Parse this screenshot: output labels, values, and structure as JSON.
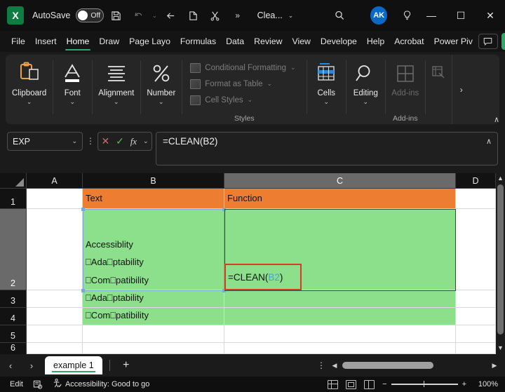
{
  "titlebar": {
    "logo": "X",
    "autosave_label": "AutoSave",
    "autosave_state": "Off",
    "icons": [
      "save-icon",
      "undo-icon",
      "redo-icon",
      "paste-icon",
      "cut-icon",
      "more-icon"
    ],
    "document_title": "Clea...",
    "avatar_initials": "AK",
    "minimize": "—",
    "maximize": "☐",
    "close": "✕"
  },
  "tabs": [
    {
      "label": "File",
      "active": false
    },
    {
      "label": "Insert",
      "active": false
    },
    {
      "label": "Home",
      "active": true
    },
    {
      "label": "Draw",
      "active": false
    },
    {
      "label": "Page Layo",
      "active": false
    },
    {
      "label": "Formulas",
      "active": false
    },
    {
      "label": "Data",
      "active": false
    },
    {
      "label": "Review",
      "active": false
    },
    {
      "label": "View",
      "active": false
    },
    {
      "label": "Develope",
      "active": false
    },
    {
      "label": "Help",
      "active": false
    },
    {
      "label": "Acrobat",
      "active": false
    },
    {
      "label": "Power Piv",
      "active": false
    }
  ],
  "ribbon": {
    "groups": [
      {
        "label": "Clipboard",
        "icon": "clipboard-icon",
        "disabled": false
      },
      {
        "label": "Font",
        "icon": "font-a-icon",
        "disabled": false
      },
      {
        "label": "Alignment",
        "icon": "alignment-lines-icon",
        "disabled": false
      },
      {
        "label": "Number",
        "icon": "percent-icon",
        "disabled": false
      }
    ],
    "styles": {
      "footer": "Styles",
      "items": [
        {
          "label": "Conditional Formatting",
          "has_chevron": true
        },
        {
          "label": "Format as Table",
          "has_chevron": true
        },
        {
          "label": "Cell Styles",
          "has_chevron": true
        }
      ]
    },
    "cells_group": {
      "label": "Cells",
      "icon": "cells-table-icon"
    },
    "editing_group": {
      "label": "Editing",
      "icon": "magnifier-icon"
    },
    "addins_group": {
      "label": "Add-ins",
      "footer": "Add-ins",
      "icon": "addins-grid-icon"
    },
    "overflow_label": "›",
    "collapse_label": "∧"
  },
  "formulabar": {
    "namebox_value": "EXP",
    "namebox_chevron": "∨",
    "cancel_icon": "✕",
    "enter_icon": "✓",
    "fx_label": "fx",
    "fx_chevron": "∨",
    "formula_value": "=CLEAN(B2)",
    "expand_icon": "∧"
  },
  "grid": {
    "columns": [
      {
        "label": "A",
        "selected": false
      },
      {
        "label": "B",
        "selected": false
      },
      {
        "label": "C",
        "selected": true
      },
      {
        "label": "D",
        "selected": false
      }
    ],
    "rows": [
      {
        "label": "1",
        "selected": false
      },
      {
        "label": "2",
        "selected": true
      },
      {
        "label": "3",
        "selected": false
      },
      {
        "label": "4",
        "selected": false
      },
      {
        "label": "5",
        "selected": false
      },
      {
        "label": "6",
        "selected": false
      }
    ],
    "cells": {
      "b1": "Text",
      "c1": "Function",
      "b2": "Accessiblity\n⎕Ada⎕ptability\n⎕Com⎕patibility",
      "b3": "⎕Ada⎕ptability",
      "b4": "⎕Com⎕patibility"
    },
    "edit_cell": {
      "prefix": "=CLEAN(",
      "reference": "B2",
      "suffix": ")"
    },
    "colors": {
      "header_fill": "#ED7D31",
      "data_fill": "#8CE08C",
      "edit_border": "#D83A26",
      "reference": "#4A9FE0"
    }
  },
  "sheetbar": {
    "prev_icon": "‹",
    "next_icon": "›",
    "tabs": [
      {
        "label": "example 1",
        "active": true
      }
    ],
    "add_label": "+",
    "kebab": "⋮"
  },
  "statusbar": {
    "mode": "Edit",
    "record_macro_icon": "record-macro-icon",
    "accessibility": "Accessibility: Good to go",
    "views": [
      "normal-view-icon",
      "page-layout-view-icon",
      "page-break-view-icon"
    ],
    "zoom_minus": "−",
    "zoom_plus": "+",
    "zoom_value": "100%"
  }
}
